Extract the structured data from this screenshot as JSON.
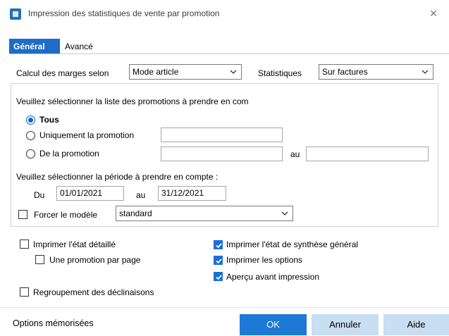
{
  "window": {
    "title": "Impression des statistiques de vente par promotion",
    "close_glyph": "×"
  },
  "tabs": [
    {
      "label": "Général",
      "active": true
    },
    {
      "label": "Avancé",
      "active": false
    }
  ],
  "margins": {
    "label": "Calcul des marges selon",
    "value": "Mode article"
  },
  "statistics": {
    "label": "Statistiques",
    "value": "Sur factures"
  },
  "promotions": {
    "heading": "Veuillez sélectionner la liste des promotions à prendre en com",
    "options": [
      {
        "label": "Tous",
        "selected": true
      },
      {
        "label": "Uniquement la promotion",
        "selected": false
      },
      {
        "label": "De la promotion",
        "selected": false
      }
    ],
    "only_value": "",
    "from_value": "",
    "to_label": "au",
    "to_value": ""
  },
  "period": {
    "heading": "Veuillez sélectionner la période à prendre en compte :",
    "from_label": "Du",
    "from_value": "01/01/2021",
    "to_label": "au",
    "to_value": "31/12/2021"
  },
  "model": {
    "force_label": "Forcer le modèle",
    "force_checked": false,
    "value": "standard"
  },
  "print_options": {
    "detailed": {
      "label": "Imprimer l'état détaillé",
      "checked": false
    },
    "one_per_page": {
      "label": "Une promotion par page",
      "checked": false
    },
    "synthesis": {
      "label": "Imprimer l'état de synthèse général",
      "checked": true
    },
    "options": {
      "label": "Imprimer les options",
      "checked": true
    },
    "preview": {
      "label": "Aperçu avant impression",
      "checked": true
    },
    "grouping": {
      "label": "Regroupement des déclinaisons",
      "checked": false
    }
  },
  "footer": {
    "memorized": "Options mémorisées",
    "ok": "OK",
    "cancel": "Annuler",
    "help": "Aide"
  },
  "colors": {
    "accent": "#1e6cc8",
    "primary_button": "#1e78d6",
    "secondary_button": "#c9def3"
  }
}
